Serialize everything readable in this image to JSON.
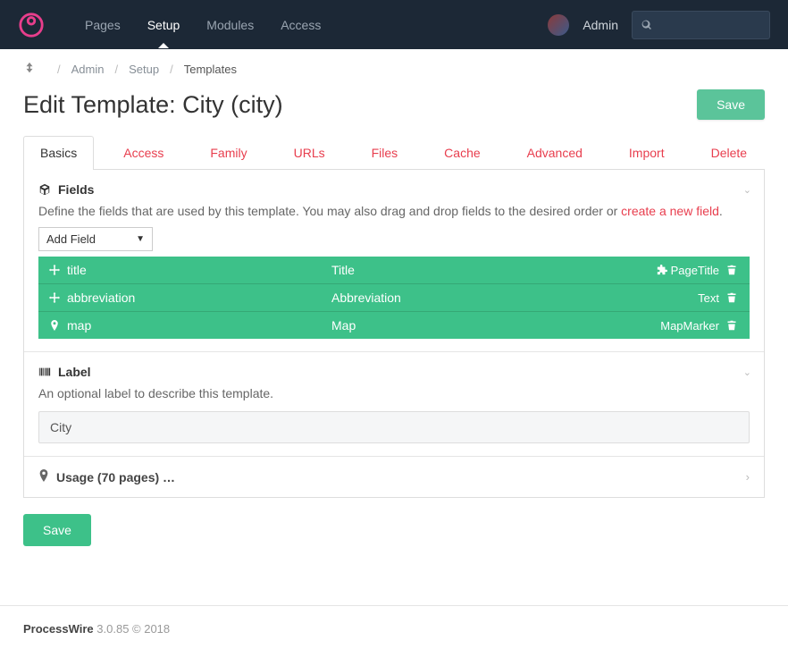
{
  "nav": {
    "items": [
      {
        "label": "Pages",
        "active": false
      },
      {
        "label": "Setup",
        "active": true
      },
      {
        "label": "Modules",
        "active": false
      },
      {
        "label": "Access",
        "active": false
      }
    ],
    "user": "Admin"
  },
  "breadcrumb": {
    "items": [
      "Admin",
      "Setup",
      "Templates"
    ]
  },
  "page": {
    "title": "Edit Template: City (city)",
    "save_label": "Save"
  },
  "tabs": [
    {
      "label": "Basics",
      "active": true
    },
    {
      "label": "Access"
    },
    {
      "label": "Family"
    },
    {
      "label": "URLs"
    },
    {
      "label": "Files"
    },
    {
      "label": "Cache"
    },
    {
      "label": "Advanced"
    },
    {
      "label": "Import"
    },
    {
      "label": "Delete"
    }
  ],
  "fields_section": {
    "title": "Fields",
    "desc_prefix": "Define the fields that are used by this template. You may also drag and drop fields to the desired order or ",
    "desc_link": "create a new field",
    "add_field_label": "Add Field",
    "rows": [
      {
        "name": "title",
        "label": "Title",
        "type": "PageTitle",
        "icon": "move",
        "type_icon": true
      },
      {
        "name": "abbreviation",
        "label": "Abbreviation",
        "type": "Text",
        "icon": "move"
      },
      {
        "name": "map",
        "label": "Map",
        "type": "MapMarker",
        "icon": "marker"
      }
    ]
  },
  "label_section": {
    "title": "Label",
    "desc": "An optional label to describe this template.",
    "value": "City"
  },
  "usage_section": {
    "text": "Usage (70 pages) …"
  },
  "footer": {
    "product": "ProcessWire",
    "version": "3.0.85 © 2018"
  }
}
